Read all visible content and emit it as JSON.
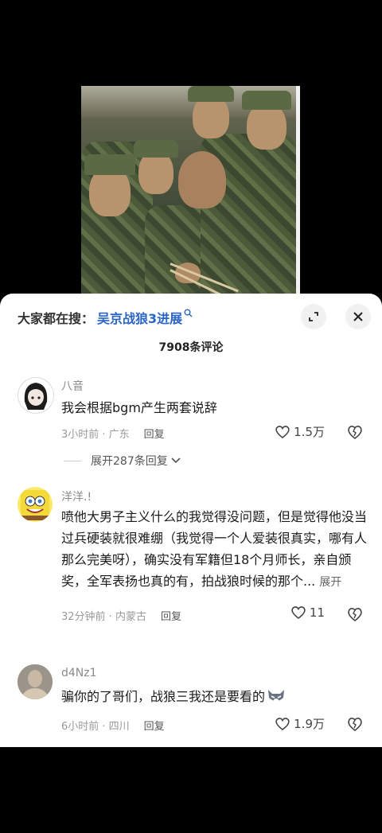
{
  "header": {
    "search_prefix": "大家都在搜：",
    "search_keyword": "吴京战狼3进展",
    "search_icon": "search-icon",
    "expand_icon": "expand-icon",
    "close_icon": "close-icon",
    "comment_count": "7908条评论"
  },
  "comments": [
    {
      "username": "八音",
      "text": "我会根据bgm产生两套说辞",
      "time": "3小时前 · 广东",
      "reply_label": "回复",
      "likes": "1.5万",
      "more_replies": "展开287条回复"
    },
    {
      "username": "洋洋.!",
      "text": "喷他大男子主义什么的我觉得没问题，但是觉得他没当过兵硬装就很难绷（我觉得一个人爱装很真实，哪有人那么完美呀），确实没有军籍但18个月师长，亲自颁奖，全军表扬也真的有，拍战狼时候的那个...",
      "expand_label": "展开",
      "time": "32分钟前 · 内蒙古",
      "reply_label": "回复",
      "likes": "11"
    },
    {
      "username": "d4Nz1",
      "text": "骗你的了哥们，战狼三我还是要看的",
      "time": "6小时前 · 四川",
      "reply_label": "回复",
      "likes": "1.9万"
    }
  ]
}
